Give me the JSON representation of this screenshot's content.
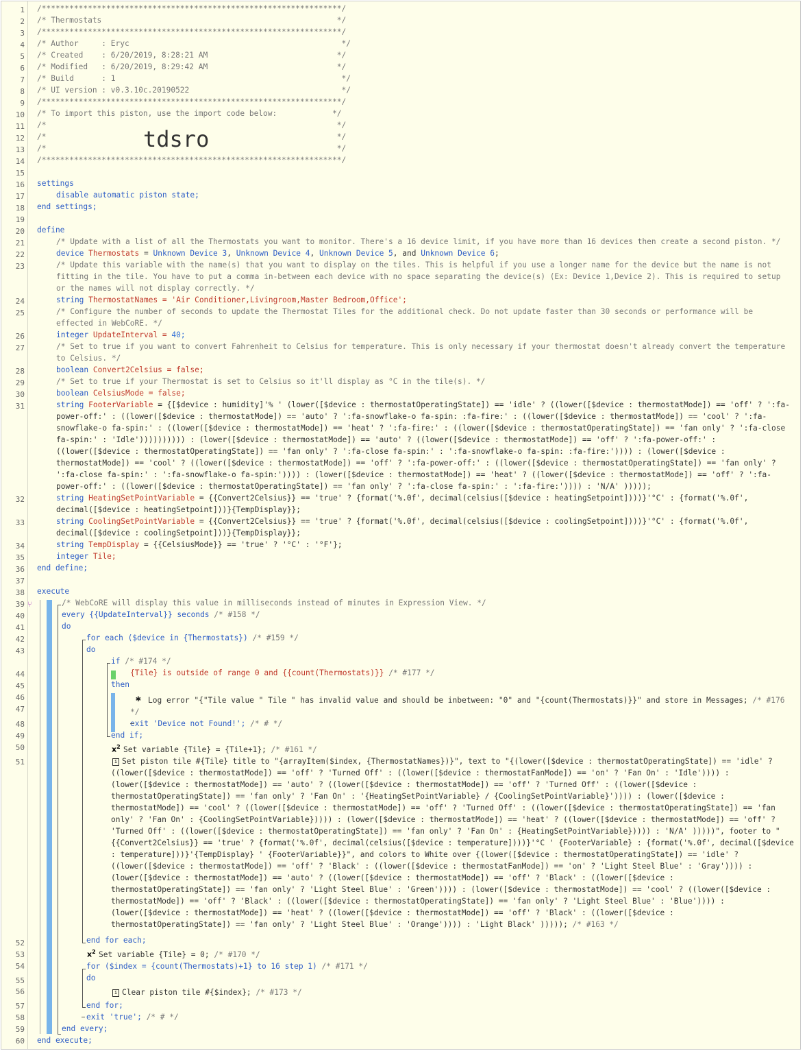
{
  "header": {
    "border_line": "/*****************************************************************/",
    "title_line": "/* Thermostats                                                   */",
    "author_line": "/* Author     : Eryc                                              */",
    "created_line": "/* Created    : 6/20/2019, 8:28:21 AM                            */",
    "modified_line": "/* Modified   : 6/20/2019, 8:29:42 AM                            */",
    "build_line": "/* Build      : 1                                                 */",
    "ui_line": "/* UI version : v0.3.10c.20190522                                 */",
    "import_line": "/* To import this piston, use the import code below:            */",
    "blank_line": "/*                                                               */",
    "import_code": "tdsro"
  },
  "line_numbers": [
    "1",
    "2",
    "3",
    "4",
    "5",
    "6",
    "7",
    "8",
    "9",
    "10",
    "11",
    "12",
    "13",
    "14",
    "15",
    "16",
    "17",
    "18",
    "19",
    "20",
    "21",
    "22",
    "23",
    "24",
    "25",
    "26",
    "27",
    "28",
    "29",
    "30",
    "31",
    "32",
    "33",
    "34",
    "35",
    "36",
    "37",
    "38",
    "39",
    "40",
    "41",
    "42",
    "43",
    "44",
    "45",
    "46",
    "47",
    "48",
    "49",
    "50",
    "51",
    "52",
    "53",
    "54",
    "55",
    "56",
    "57",
    "58",
    "59",
    "60"
  ],
  "settings": {
    "open": "settings",
    "line": "disable automatic piston state;",
    "close": "end settings;"
  },
  "define": {
    "open": "define",
    "close": "end define;",
    "comment1": "/* Update with a list of all the Thermostats you want to monitor. There's a 16 device limit, if you have more than 16 devices then create a second piston. */",
    "device_kw": "device",
    "device_name": "Thermostats",
    "devices": [
      "Unknown Device 3",
      "Unknown Device 4",
      "Unknown Device 5",
      "Unknown Device 6"
    ],
    "comment2a": "/* Update this variable with the name(s) that you want to display on the tiles. This is helpful if you use a longer name for the device but the name is not",
    "comment2b": "fitting in the tile. You have to put a comma in-between each device with no space separating the device(s) (Ex: Device 1,Device 2). This is required to setup",
    "comment2c": "or the names will not display correctly. */",
    "names_kw": "string",
    "names_var": "ThermostatNames",
    "names_val": "'Air Conditioner,Livingroom,Master Bedroom,Office'",
    "comment3a": "/* Configure the number of seconds to update the Thermostat Tiles for the additional check. Do not update faster than 30 seconds or performance will be",
    "comment3b": "effected in WebCoRE. */",
    "interval_kw": "integer",
    "interval_var": "UpdateInterval",
    "interval_val": "40",
    "comment4a": "/* Set to true if you want to convert Fahrenheit to Celsius for temperature. This is only necessary if your thermostat doesn't already convert the temperature",
    "comment4b": "to Celsius. */",
    "conv_kw": "boolean",
    "conv_var": "Convert2Celsius",
    "conv_val": "false",
    "comment5": "/* Set to true if your Thermostat is set to Celsius so it'll display as °C in the tile(s). */",
    "cm_kw": "boolean",
    "cm_var": "CelsiusMode",
    "cm_val": "false",
    "footer_kw": "string",
    "footer_var": "FooterVariable",
    "footer_l1": "= {[$device : humidity]'% ' (lower([$device : thermostatOperatingState]) == 'idle' ? ((lower([$device : thermostatMode]) == 'off' ? ':fa-",
    "footer_l2": "power-off:' : ((lower([$device : thermostatMode]) == 'auto' ? ':fa-snowflake-o fa-spin: :fa-fire:' : ((lower([$device : thermostatMode]) == 'cool' ? ':fa-",
    "footer_l3": "snowflake-o fa-spin:' : ((lower([$device : thermostatMode]) == 'heat' ? ':fa-fire:' : ((lower([$device : thermostatOperatingState]) == 'fan only' ? ':fa-close",
    "footer_l4": "fa-spin:' : 'Idle')))))))))) : (lower([$device : thermostatMode]) == 'auto' ? ((lower([$device : thermostatMode]) == 'off' ? ':fa-power-off:' :",
    "footer_l5": "((lower([$device : thermostatOperatingState]) == 'fan only' ? ':fa-close fa-spin:' : ':fa-snowflake-o fa-spin: :fa-fire:')))) : (lower([$device :",
    "footer_l6": "thermostatMode]) == 'cool' ? ((lower([$device : thermostatMode]) == 'off' ? ':fa-power-off:' : ((lower([$device : thermostatOperatingState]) == 'fan only' ?",
    "footer_l7": "':fa-close fa-spin:' : ':fa-snowflake-o fa-spin:')))) : (lower([$device : thermostatMode]) == 'heat' ? ((lower([$device : thermostatMode]) == 'off' ? ':fa-",
    "footer_l8": "power-off:' : ((lower([$device : thermostatOperatingState]) == 'fan only' ? ':fa-close fa-spin:' : ':fa-fire:')))) : 'N/A' )))));",
    "heat_kw": "string",
    "heat_var": "HeatingSetPointVariable",
    "heat_l1": "= {{Convert2Celsius}} == 'true' ? {format('%.0f', decimal(celsius([$device : heatingSetpoint])))}'°C' : {format('%.0f',",
    "heat_l2": "decimal([$device : heatingSetpoint]))}{TempDisplay}};",
    "cool_kw": "string",
    "cool_var": "CoolingSetPointVariable",
    "cool_l1": "= {{Convert2Celsius}} == 'true' ? {format('%.0f', decimal(celsius([$device : coolingSetpoint])))}'°C' : {format('%.0f',",
    "cool_l2": "decimal([$device : coolingSetpoint]))}{TempDisplay}};",
    "temp_kw": "string",
    "temp_var": "TempDisplay",
    "temp_val": "= {{CelsiusMode}} == 'true' ? '°C' : '°F'};",
    "tile_kw": "integer",
    "tile_var": "Tile"
  },
  "execute": {
    "open": "execute",
    "comment": "/* WebCoRE will display this value in milliseconds instead of minutes in Expression View. */",
    "every": "every {{UpdateInterval}} seconds",
    "every_id": "/* #158 */",
    "do": "do",
    "for_each": "for each ($device in {Thermostats})",
    "for_each_id": "/* #159 */",
    "do2": "do",
    "if": "if",
    "if_id": "/* #174 */",
    "cond": "{Tile} is outside of range 0 and {{count(Thermostats)}}",
    "cond_id": "/* #177 */",
    "then": "then",
    "log": "Log error \"{\"Tile value \" Tile \" has invalid value and should be inbetween: \"0\" and \"{count(Thermostats)}}\" and store in Messages;",
    "log_id": "/* #176",
    "log_id2": "*/",
    "exit1": "exit 'Device not Found!';",
    "exit1_id": "/* # */",
    "endif": "end if;",
    "set1": "Set variable {Tile} = {Tile+1};",
    "set1_id": "/* #161 */",
    "tile_l1": "Set piston tile #{Tile} title to \"{arrayItem($index, {ThermostatNames})}\", text to \"{(lower([$device : thermostatOperatingState]) == 'idle' ?",
    "tile_l2": "((lower([$device : thermostatMode]) == 'off' ? 'Turned Off' : ((lower([$device : thermostatFanMode]) == 'on' ? 'Fan On' : 'Idle')))) :",
    "tile_l3": "(lower([$device : thermostatMode]) == 'auto' ? ((lower([$device : thermostatMode]) == 'off' ? 'Turned Off' : ((lower([$device :",
    "tile_l4": "thermostatOperatingState]) == 'fan only' ? 'Fan On' : '{HeatingSetPointVariable} / {CoolingSetPointVariable}')))) : (lower([$device :",
    "tile_l5": "thermostatMode]) == 'cool' ? ((lower([$device : thermostatMode]) == 'off' ? 'Turned Off' : ((lower([$device : thermostatOperatingState]) == 'fan",
    "tile_l6": "only' ? 'Fan On' : {CoolingSetPointVariable})))) : (lower([$device : thermostatMode]) == 'heat' ? ((lower([$device : thermostatMode]) == 'off' ?",
    "tile_l7": "'Turned Off' : ((lower([$device : thermostatOperatingState]) == 'fan only' ? 'Fan On' : {HeatingSetPointVariable})))) : 'N/A' )))))\", footer to \"",
    "tile_l8": "{{Convert2Celsius}} == 'true' ? {format('%.0f', decimal(celsius([$device : temperature])))}'°C ' {FooterVariable} : {format('%.0f', decimal([$device",
    "tile_l9": ": temperature]))}'{TempDisplay} ' {FooterVariable}}\", and colors to White over {(lower([$device : thermostatOperatingState]) == 'idle' ?",
    "tile_l10": "((lower([$device : thermostatMode]) == 'off' ? 'Black' : ((lower([$device : thermostatFanMode]) == 'on' ? 'Light Steel Blue' : 'Gray')))) :",
    "tile_l11": "(lower([$device : thermostatMode]) == 'auto' ? ((lower([$device : thermostatMode]) == 'off' ? 'Black' : ((lower([$device :",
    "tile_l12": "thermostatOperatingState]) == 'fan only' ? 'Light Steel Blue' : 'Green')))) : (lower([$device : thermostatMode]) == 'cool' ? ((lower([$device :",
    "tile_l13": "thermostatMode]) == 'off' ? 'Black' : ((lower([$device : thermostatOperatingState]) == 'fan only' ? 'Light Steel Blue' : 'Blue')))) :",
    "tile_l14": "(lower([$device : thermostatMode]) == 'heat' ? ((lower([$device : thermostatMode]) == 'off' ? 'Black' : ((lower([$device :",
    "tile_l15": "thermostatOperatingState]) == 'fan only' ? 'Light Steel Blue' : 'Orange')))) : 'Light Black' )))));",
    "tile_id": "/* #163 */",
    "endforeach": "end for each;",
    "set2": "Set variable {Tile} = 0;",
    "set2_id": "/* #170 */",
    "for": "for ($index = {count(Thermostats)+1} to 16 step 1)",
    "for_id": "/* #171 */",
    "do3": "do",
    "clear": "Clear piston tile #{$index};",
    "clear_id": "/* #173 */",
    "endfor": "end for;",
    "exit2": "exit 'true';",
    "exit2_id": "/* # */",
    "endevery": "end every;",
    "close": "end execute;"
  },
  "colors": {
    "background": "#fefeea",
    "keyword": "#2c5cc6",
    "variable": "#c0392b",
    "comment": "#777777",
    "block_bar": "#78b4ea",
    "condition_box": "#6ad16a"
  }
}
